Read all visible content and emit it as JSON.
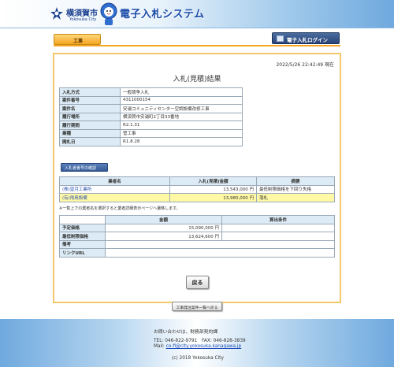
{
  "header": {
    "city_name": "横須賀市",
    "city_name_en": "Yokosuka City",
    "system_title": "電子入札システム"
  },
  "nav": {
    "tab_label": "工事",
    "login_label": "電子入札ログイン"
  },
  "page": {
    "timestamp": "2022/5/26 22:42:49 現在",
    "title": "入札(見積)結果"
  },
  "info": [
    {
      "label": "入札方式",
      "value": "一般競争入札"
    },
    {
      "label": "案件番号",
      "value": "4311000154"
    },
    {
      "label": "案件名",
      "value": "安浦コミュニティセンター空調設備改修工事"
    },
    {
      "label": "履行場所",
      "value": "横須賀市安浦町2丁目33番地"
    },
    {
      "label": "履行期間",
      "value": "R2.1.31"
    },
    {
      "label": "業種",
      "value": "管工事"
    },
    {
      "label": "開札日",
      "value": "R1.8.28"
    }
  ],
  "confirm_button": "入札者番号の確認",
  "results": {
    "headers": [
      "業者名",
      "入札(見積)金額",
      "摘要"
    ],
    "rows": [
      {
        "name": "(株)望月工業所",
        "amount": "13,543,000 円",
        "note": "最低制限価格を下回り失格"
      },
      {
        "name": "(有)飛鳥設備",
        "amount": "13,980,000 円",
        "note": "落札"
      }
    ]
  },
  "results_note": "※一覧上での業者名を選択すると業者詳細表示ページへ遷移します。",
  "prices": {
    "headers": [
      "金額",
      "算出条件"
    ],
    "rows": [
      {
        "label": "予定価格",
        "amount": "15,090,000 円",
        "condition": ""
      },
      {
        "label": "最低制限価格",
        "amount": "13,624,600 円",
        "condition": ""
      },
      {
        "label": "備考",
        "amount": "",
        "condition": ""
      },
      {
        "label": "リンクURL",
        "amount": "",
        "condition": ""
      }
    ]
  },
  "back_button": "戻る",
  "list_button": "工事発注案件一覧へ戻る",
  "footer": {
    "contact": "お問い合わせは、財務部契約課",
    "tel_fax": "TEL: 046-822-9791　FAX: 046-828-3839",
    "mail_label": "Mail: ",
    "mail": "co-fi@city.yokosuka.kanagawa.jp",
    "copyright": "(c) 2018 Yokosuka City"
  },
  "colors": {
    "header_blue": "#6fa9de",
    "tab_orange": "#f5a623",
    "table_label_bg": "#dcebf5",
    "winner_highlight": "#fff9a6",
    "link_blue": "#2a4fb0"
  }
}
